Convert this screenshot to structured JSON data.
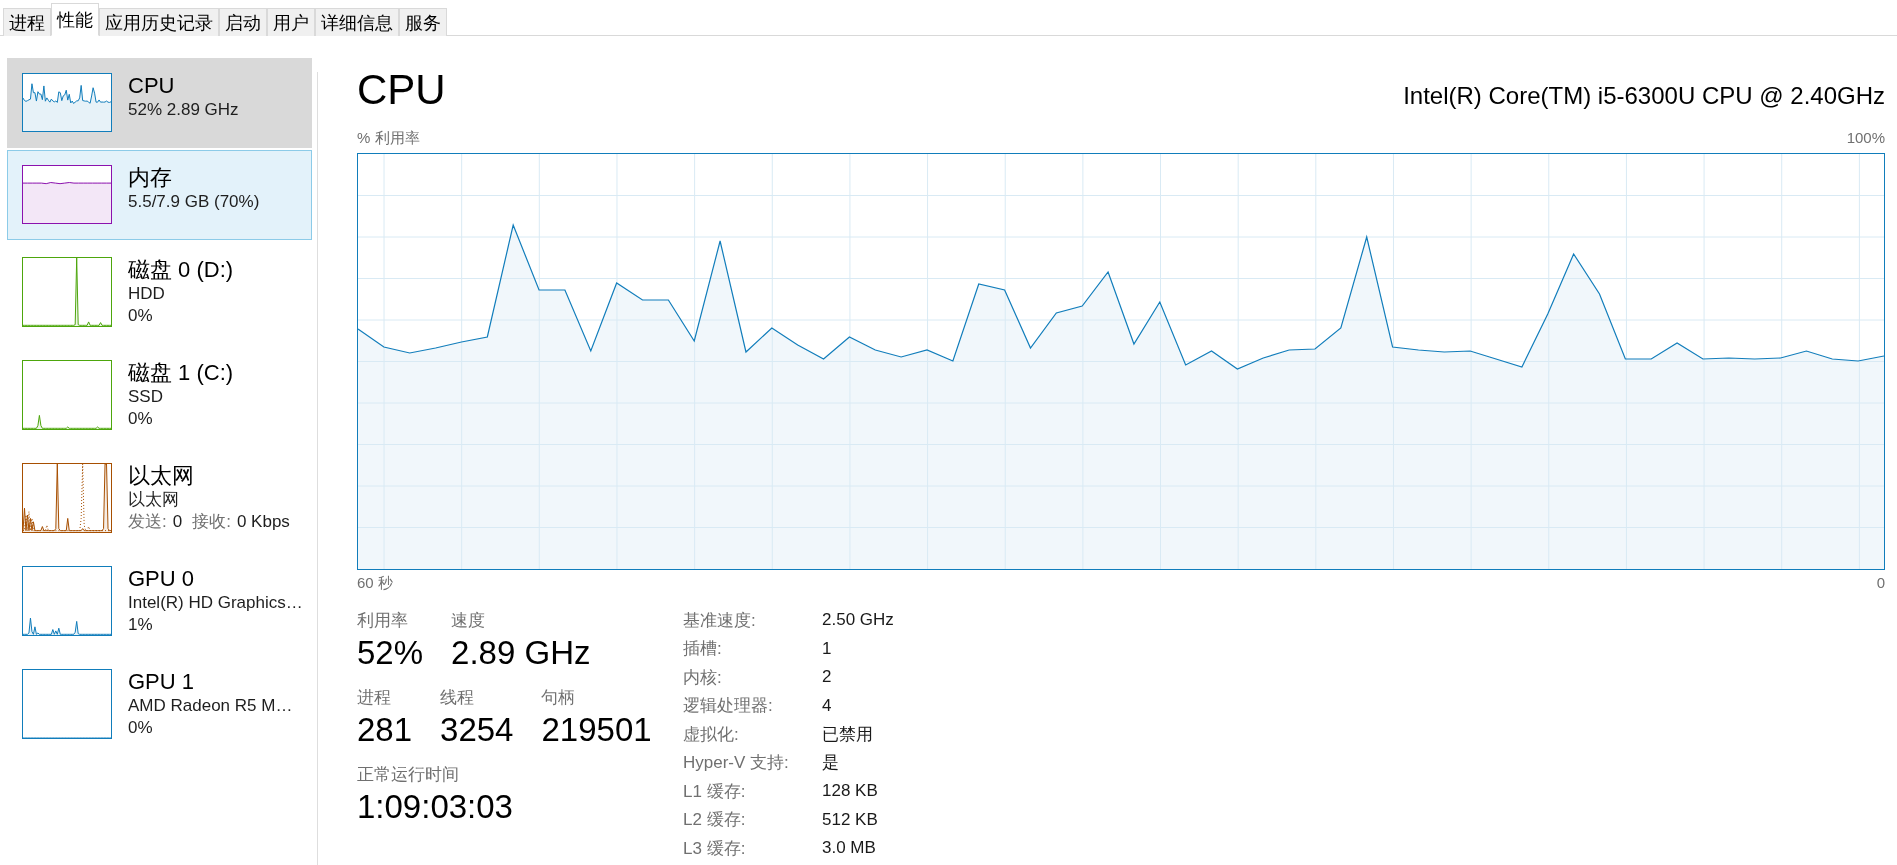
{
  "tabs": [
    {
      "label": "进程",
      "selected": false
    },
    {
      "label": "性能",
      "selected": true
    },
    {
      "label": "应用历史记录",
      "selected": false
    },
    {
      "label": "启动",
      "selected": false
    },
    {
      "label": "用户",
      "selected": false
    },
    {
      "label": "详细信息",
      "selected": false
    },
    {
      "label": "服务",
      "selected": false
    }
  ],
  "sidebar": {
    "items": [
      {
        "title": "CPU",
        "lines": [
          "52% 2.89 GHz"
        ],
        "color": "#117dbb",
        "selected": true,
        "hovered": false
      },
      {
        "title": "内存",
        "lines": [
          "5.5/7.9 GB (70%)"
        ],
        "color": "#8b12ae",
        "selected": false,
        "hovered": true
      },
      {
        "title": "磁盘 0 (D:)",
        "lines": [
          "HDD",
          "0%"
        ],
        "color": "#4da60c",
        "selected": false,
        "hovered": false
      },
      {
        "title": "磁盘 1 (C:)",
        "lines": [
          "SSD",
          "0%"
        ],
        "color": "#4da60c",
        "selected": false,
        "hovered": false
      },
      {
        "title": "以太网",
        "lines": [
          "以太网"
        ],
        "rates": [
          {
            "label": "发送:",
            "value": "0"
          },
          {
            "label": "接收:",
            "value": "0 Kbps"
          }
        ],
        "color": "#a74f01",
        "selected": false,
        "hovered": false
      },
      {
        "title": "GPU 0",
        "lines": [
          "Intel(R) HD Graphics…",
          "1%"
        ],
        "color": "#117dbb",
        "selected": false,
        "hovered": false
      },
      {
        "title": "GPU 1",
        "lines": [
          "AMD Radeon R5 M…",
          "0%"
        ],
        "color": "#117dbb",
        "selected": false,
        "hovered": false
      }
    ]
  },
  "detail": {
    "title": "CPU",
    "model": "Intel(R) Core(TM) i5-6300U CPU @ 2.40GHz",
    "graph": {
      "axis_title": "% 利用率",
      "max_label": "100%",
      "start_label": "60 秒",
      "end_label": "0"
    },
    "stat_rows": [
      [
        {
          "label": "利用率",
          "value": "52%"
        },
        {
          "label": "速度",
          "value": "2.89 GHz"
        }
      ],
      [
        {
          "label": "进程",
          "value": "281"
        },
        {
          "label": "线程",
          "value": "3254"
        },
        {
          "label": "句柄",
          "value": "219501"
        }
      ],
      [
        {
          "label": "正常运行时间",
          "value": "1:09:03:03"
        }
      ]
    ],
    "specs": [
      {
        "label": "基准速度:",
        "value": "2.50 GHz"
      },
      {
        "label": "插槽:",
        "value": "1"
      },
      {
        "label": "内核:",
        "value": "2"
      },
      {
        "label": "逻辑处理器:",
        "value": "4"
      },
      {
        "label": "虚拟化:",
        "value": "已禁用"
      },
      {
        "label": "Hyper-V 支持:",
        "value": "是"
      },
      {
        "label": "L1 缓存:",
        "value": "128 KB"
      },
      {
        "label": "L2 缓存:",
        "value": "512 KB"
      },
      {
        "label": "L3 缓存:",
        "value": "3.0 MB"
      }
    ]
  }
}
